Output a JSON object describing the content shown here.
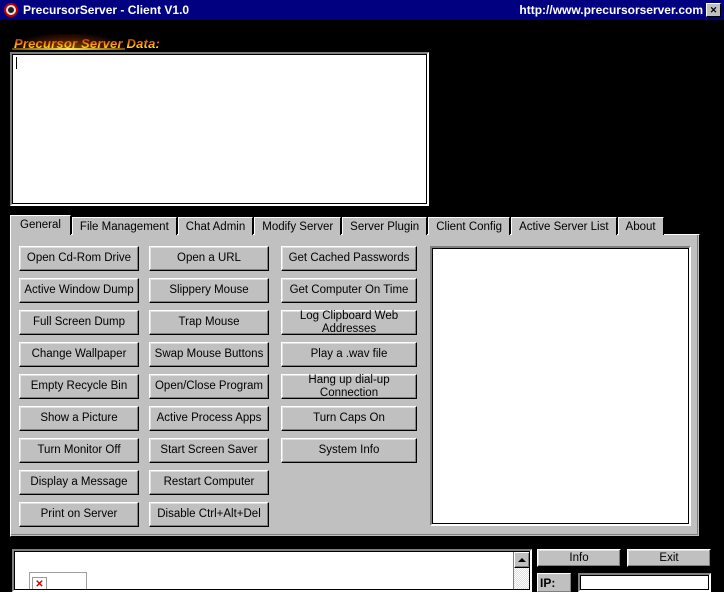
{
  "window": {
    "title": "PrecursorServer - Client V1.0",
    "url": "http://www.precursorserver.com",
    "close_label": "✕",
    "icon": "precursor-ring-icon",
    "colors": {
      "titlebar": "#000080",
      "desktop": "#000000",
      "face": "#c0c0c0",
      "fire_text": "#ffd21a"
    }
  },
  "data_section": {
    "label": "Precursor Server Data:",
    "value": "",
    "placeholder": ""
  },
  "tabs": [
    {
      "label": "General",
      "selected": true
    },
    {
      "label": "File Management",
      "selected": false
    },
    {
      "label": "Chat Admin",
      "selected": false
    },
    {
      "label": "Modify Server",
      "selected": false
    },
    {
      "label": "Server Plugin",
      "selected": false
    },
    {
      "label": "Client Config",
      "selected": false
    },
    {
      "label": "Active Server List",
      "selected": false
    },
    {
      "label": "About",
      "selected": false
    }
  ],
  "general_tab": {
    "column1": [
      "Open Cd-Rom Drive",
      "Active Window Dump",
      "Full Screen Dump",
      "Change Wallpaper",
      "Empty Recycle Bin",
      "Show a Picture",
      "Turn Monitor Off",
      "Display a Message",
      "Print on Server"
    ],
    "column2": [
      "Open a URL",
      "Slippery Mouse",
      "Trap Mouse",
      "Swap Mouse Buttons",
      "Open/Close Program",
      "Active Process Apps",
      "Start Screen Saver",
      "Restart Computer",
      "Disable Ctrl+Alt+Del"
    ],
    "column3": [
      "Get Cached Passwords",
      "Get Computer On Time",
      "Log Clipboard Web Addresses",
      "Play a .wav file",
      "Hang up dial-up Connection",
      "Turn Caps On",
      "System Info"
    ],
    "output_panel": ""
  },
  "bottom": {
    "log_value": "",
    "broken_image_icon": "broken-image-icon",
    "info_label": "Info",
    "exit_label": "Exit",
    "ip_label": "IP:",
    "ip_value": ""
  }
}
